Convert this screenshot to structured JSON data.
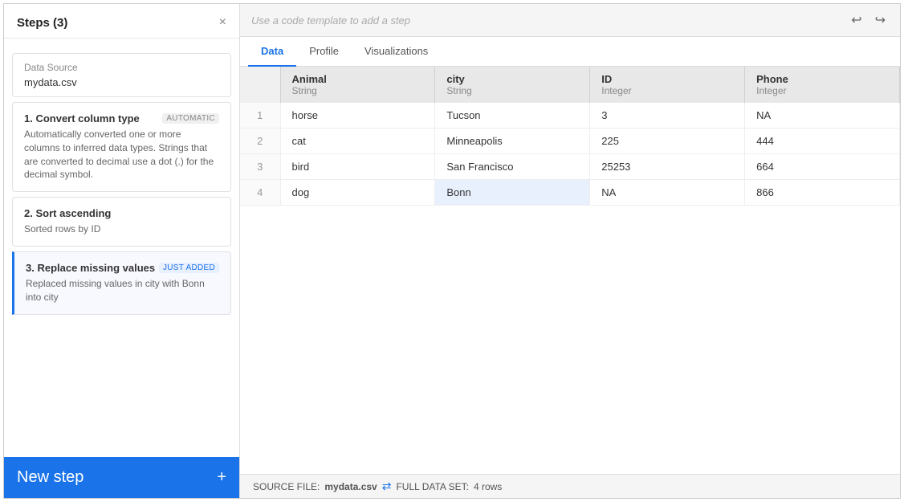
{
  "sidebar": {
    "title": "Steps (3)",
    "close_label": "×",
    "data_source": {
      "label": "Data Source",
      "filename": "mydata.csv"
    },
    "steps": [
      {
        "id": "step-1",
        "label": "1. Convert column type",
        "badge": "AUTOMATIC",
        "badge_type": "normal",
        "description": "Automatically converted one or more columns to inferred data types. Strings that are converted to decimal use a dot (.) for the decimal symbol.",
        "active": false
      },
      {
        "id": "step-2",
        "label": "2. Sort ascending",
        "badge": "",
        "badge_type": "normal",
        "description": "Sorted rows by ID",
        "active": false
      },
      {
        "id": "step-3",
        "label": "3. Replace missing values",
        "badge": "JUST ADDED",
        "badge_type": "just-added",
        "description": "Replaced missing values in city with Bonn into city",
        "active": true
      }
    ],
    "new_step_label": "New step",
    "new_step_icon": "+"
  },
  "toolbar": {
    "placeholder": "Use a code template to add a step",
    "undo_icon": "↩",
    "redo_icon": "↪"
  },
  "tabs": [
    {
      "label": "Data",
      "active": true
    },
    {
      "label": "Profile",
      "active": false
    },
    {
      "label": "Visualizations",
      "active": false
    }
  ],
  "table": {
    "columns": [
      {
        "name": "",
        "type": ""
      },
      {
        "name": "Animal",
        "type": "String"
      },
      {
        "name": "city",
        "type": "String"
      },
      {
        "name": "ID",
        "type": "Integer"
      },
      {
        "name": "Phone",
        "type": "Integer"
      }
    ],
    "rows": [
      {
        "row_num": "1",
        "Animal": "horse",
        "city": "Tucson",
        "ID": "3",
        "Phone": "NA",
        "highlight_city": false
      },
      {
        "row_num": "2",
        "Animal": "cat",
        "city": "Minneapolis",
        "ID": "225",
        "Phone": "444",
        "highlight_city": false
      },
      {
        "row_num": "3",
        "Animal": "bird",
        "city": "San Francisco",
        "ID": "25253",
        "Phone": "664",
        "highlight_city": false
      },
      {
        "row_num": "4",
        "Animal": "dog",
        "city": "Bonn",
        "ID": "NA",
        "Phone": "866",
        "highlight_city": true
      }
    ]
  },
  "status_bar": {
    "source_file_label": "SOURCE FILE:",
    "source_filename": "mydata.csv",
    "full_dataset_label": "FULL DATA SET:",
    "row_count": "4 rows"
  }
}
